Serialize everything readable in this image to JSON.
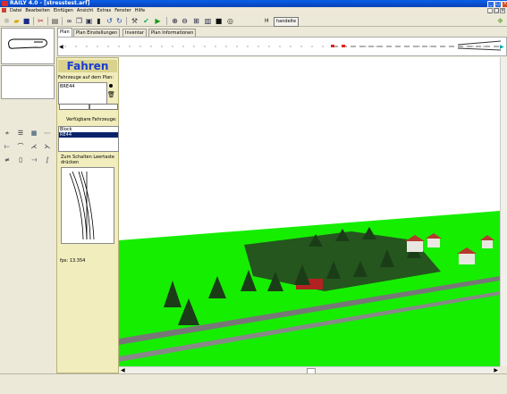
{
  "window": {
    "title": "RAILY 4.0 - [stresstest.arf]",
    "buttons": {
      "minimize": "_",
      "maximize": "□",
      "close": "×"
    }
  },
  "menu": {
    "items": [
      "Datei",
      "Bearbeiten",
      "Einfügen",
      "Ansicht",
      "Extras",
      "Fenster",
      "Hilfe"
    ],
    "mdi_buttons": {
      "minimize": "_",
      "restore": "□",
      "close": "×"
    }
  },
  "toolbar": {
    "icons": [
      "new-icon",
      "open-icon",
      "save-icon",
      "cut-icon",
      "print-icon",
      "binoculars-icon",
      "copy-icon",
      "paste-icon",
      "delete-icon",
      "undo-icon",
      "redo-icon",
      "tool-icon",
      "check-icon",
      "play-icon",
      "zoom-in-icon",
      "zoom-out-icon",
      "grid-icon",
      "chart-icon",
      "stop-icon",
      "camera-icon"
    ],
    "h_label": "H",
    "h_button": "handelte"
  },
  "tabs": [
    {
      "label": "Plan",
      "active": true
    },
    {
      "label": "Plan Einstellungen",
      "active": false
    },
    {
      "label": "Inventar",
      "active": false
    },
    {
      "label": "Plan Informationen",
      "active": false
    }
  ],
  "panel": {
    "title": "Fahren",
    "vehicles_on_plan_label": "Fahrzeuge auf dem Plan:",
    "vehicles_on_plan": [
      "BRE44"
    ],
    "available_label": "Verfügbare Fahrzeuge:",
    "available": [
      {
        "name": "Block",
        "selected": false
      },
      {
        "name": "RE44",
        "selected": true
      }
    ],
    "switch_hint": "Zum Schalten Leertaste drücken",
    "fps": "fps: 13.354"
  },
  "colors": {
    "panel_bg": "#f1edbd",
    "title_blue": "#1a3bd4",
    "ground_green": "#16ee00",
    "sky": "#ffffff"
  }
}
